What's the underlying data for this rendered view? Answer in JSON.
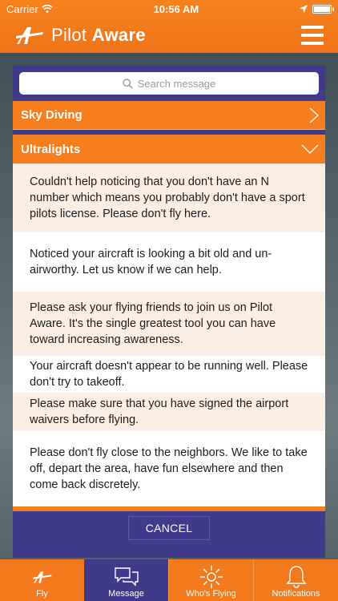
{
  "status_bar": {
    "carrier": "Carrier",
    "time": "10:56 AM"
  },
  "header": {
    "brand_light": "Pilot",
    "brand_bold": "Aware"
  },
  "search": {
    "placeholder": "Search message"
  },
  "sections": [
    {
      "label": "Sky Diving",
      "expanded": false
    },
    {
      "label": "Ultralights",
      "expanded": true
    }
  ],
  "messages": [
    "Couldn't help noticing that you don't have an N number which means you probably don't have a sport pilots license. Please don't fly here.",
    "Noticed your aircraft is looking a bit old and un-airworthy. Let us know if we can help.",
    "Please ask your flying friends to join us on Pilot Aware. It's the single greatest tool you can have toward increasing awareness.",
    "Your aircraft doesn't appear to be running well. Please don't try to takeoff.",
    "Please make sure that you have signed the airport waivers before flying.",
    "Please don't fly close to the neighbors. We like to take off, depart the area, have fun elsewhere and then come back discretely."
  ],
  "cancel_label": "CANCEL",
  "tabs": [
    {
      "label": "Fly",
      "icon": "pilot-aware-logo-icon"
    },
    {
      "label": "Message",
      "icon": "chat-bubbles-icon",
      "active": true
    },
    {
      "label": "Who's Flying",
      "icon": "sun-burst-icon"
    },
    {
      "label": "Notifications",
      "icon": "bell-icon"
    }
  ],
  "colors": {
    "orange": "#f57f1e",
    "purple": "#3f3a8a",
    "row_tint": "#fdeee3"
  }
}
